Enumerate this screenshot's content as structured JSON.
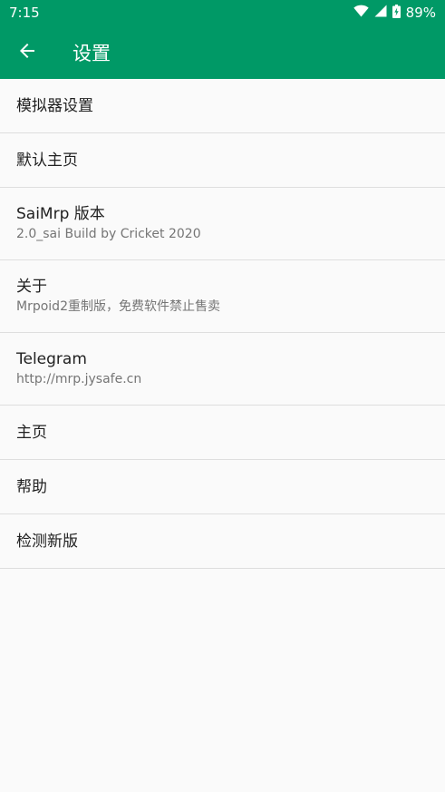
{
  "status_bar": {
    "time": "7:15",
    "battery_percent": "89%",
    "icons": [
      "wifi-icon",
      "signal-icon",
      "battery-charging-icon"
    ]
  },
  "toolbar": {
    "back_icon": "arrow-back-icon",
    "title": "设置"
  },
  "colors": {
    "primary": "#009966",
    "background": "#fafafa",
    "divider": "#dedede",
    "text_primary": "#212121",
    "text_secondary": "#757575"
  },
  "settings": {
    "items": [
      {
        "title": "模拟器设置"
      },
      {
        "title": "默认主页"
      },
      {
        "title": "SaiMrp 版本",
        "subtitle": "2.0_sai Build by Cricket 2020"
      },
      {
        "title": "关于",
        "subtitle": "Mrpoid2重制版，免费软件禁止售卖"
      },
      {
        "title": "Telegram",
        "subtitle": "http://mrp.jysafe.cn"
      },
      {
        "title": "主页"
      },
      {
        "title": "帮助"
      },
      {
        "title": "检测新版"
      }
    ]
  }
}
